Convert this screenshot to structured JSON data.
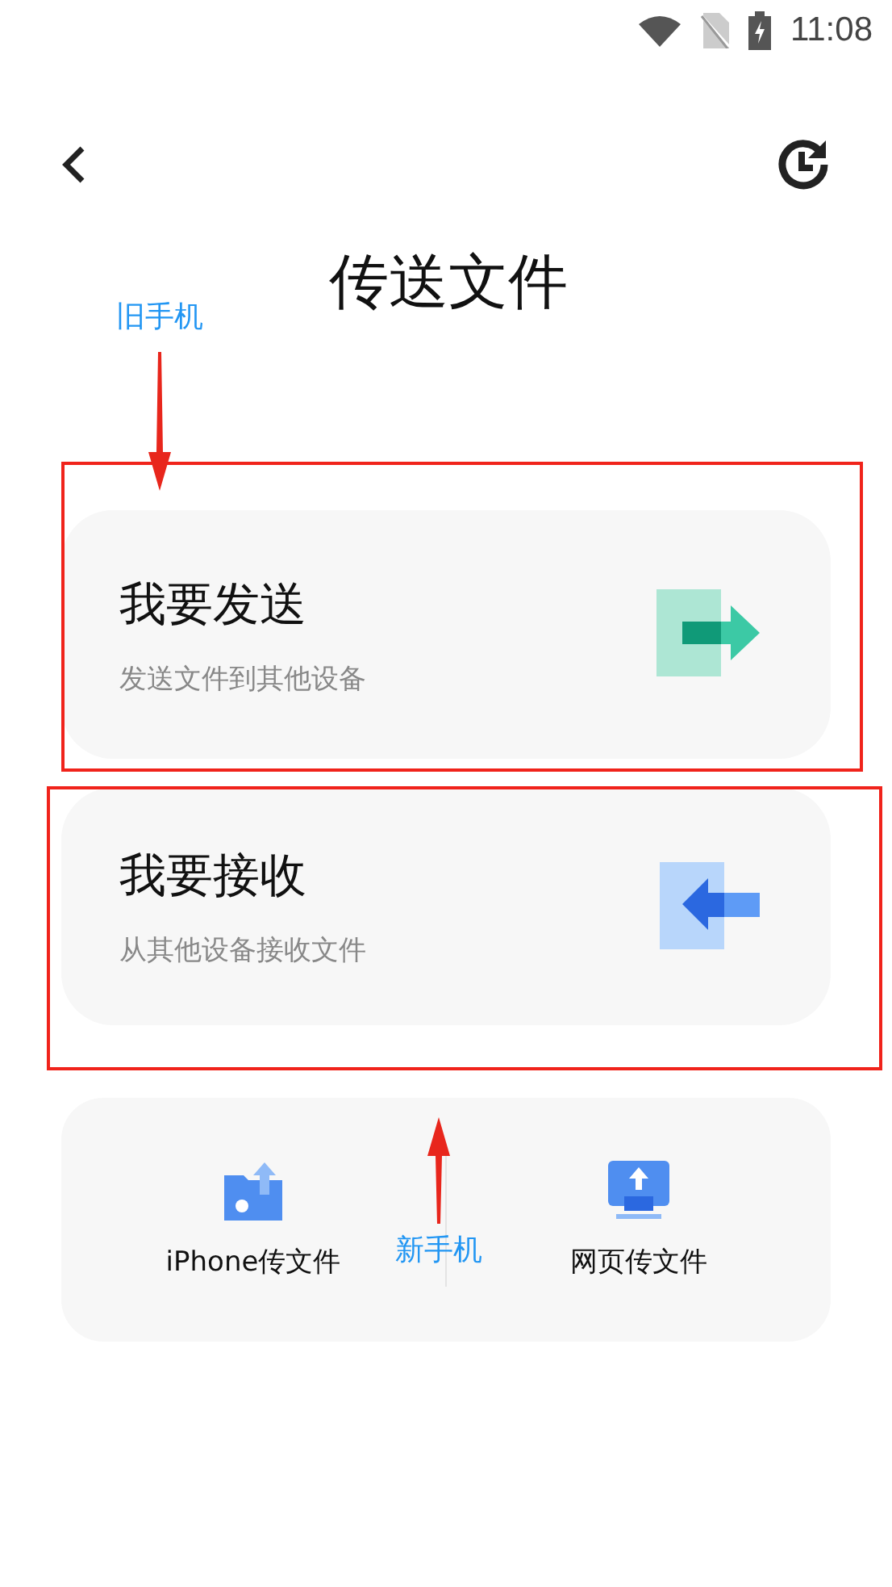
{
  "status_bar": {
    "time": "11:08"
  },
  "header": {
    "title": "传送文件"
  },
  "options": [
    {
      "kind": "send",
      "title": "我要发送",
      "subtitle": "发送文件到其他设备",
      "highlighted": true
    },
    {
      "kind": "receive",
      "title": "我要接收",
      "subtitle": "从其他设备接收文件",
      "highlighted": true
    }
  ],
  "quick_actions": [
    {
      "kind": "iphone",
      "label": "iPhone传文件"
    },
    {
      "kind": "web",
      "label": "网页传文件"
    }
  ],
  "annotations": [
    {
      "kind": "down",
      "text": "旧手机"
    },
    {
      "kind": "up",
      "text": "新手机"
    }
  ]
}
